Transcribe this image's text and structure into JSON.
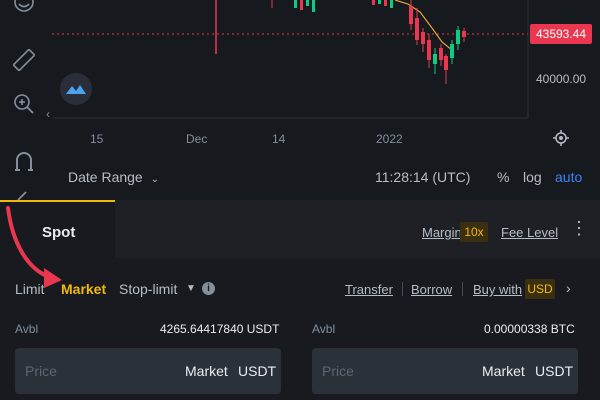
{
  "chart": {
    "x_ticks": [
      "15",
      "Dec",
      "14",
      "2022"
    ],
    "current_price": "43593.44",
    "price_level": "40000.00"
  },
  "range_bar": {
    "date_range_label": "Date Range",
    "clock": "11:28:14 (UTC)",
    "percent_label": "%",
    "log_label": "log",
    "auto_label": "auto"
  },
  "trade_tabs": {
    "spot_label": "Spot",
    "margin_label": "Margin",
    "leverage": "10x",
    "fee_level_label": "Fee Level"
  },
  "order_types": {
    "limit": "Limit",
    "market": "Market",
    "stop_limit": "Stop-limit",
    "info": "i"
  },
  "links": {
    "transfer": "Transfer",
    "borrow": "Borrow",
    "buy_with": "Buy with",
    "buy_with_currency": "USD"
  },
  "buy_side": {
    "avbl_label": "Avbl",
    "avbl_value": "4265.64417840 USDT",
    "price_placeholder": "Price",
    "price_mode": "Market",
    "unit": "USDT"
  },
  "sell_side": {
    "avbl_label": "Avbl",
    "avbl_value": "0.00000338 BTC",
    "price_placeholder": "Price",
    "price_mode": "Market",
    "unit": "USDT"
  },
  "colors": {
    "accent": "#f0b90b",
    "sell_red": "#e8374e",
    "buy_green": "#0ecb81",
    "auto_blue": "#3b82f6"
  }
}
